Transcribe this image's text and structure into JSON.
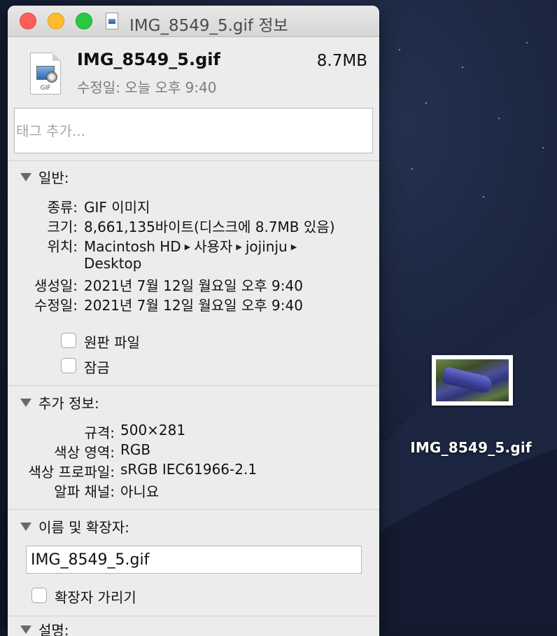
{
  "window": {
    "title": "IMG_8549_5.gif 정보"
  },
  "header": {
    "file_name": "IMG_8549_5.gif",
    "file_size": "8.7MB",
    "modified": "수정일: 오늘 오후 9:40",
    "icon_ext": "GIF"
  },
  "tags": {
    "placeholder": "태그 추가..."
  },
  "general": {
    "heading": "일반:",
    "kind_label": "종류:",
    "kind_value": "GIF 이미지",
    "size_label": "크기:",
    "size_value": "8,661,135바이트(디스크에 8.7MB 있음)",
    "where_label": "위치:",
    "where_path": [
      "Macintosh HD",
      "사용자",
      "jojinju",
      "Desktop"
    ],
    "created_label": "생성일:",
    "created_value": "2021년 7월 12일 월요일 오후 9:40",
    "modified_label": "수정일:",
    "modified_value": "2021년 7월 12일 월요일 오후 9:40",
    "stationery_label": "원판 파일",
    "locked_label": "잠금"
  },
  "more_info": {
    "heading": "추가 정보:",
    "dimensions_label": "규격:",
    "dimensions_value": "500×281",
    "color_space_label": "색상 영역:",
    "color_space_value": "RGB",
    "color_profile_label": "색상 프로파일:",
    "color_profile_value": "sRGB IEC61966-2.1",
    "alpha_label": "알파 채널:",
    "alpha_value": "아니요"
  },
  "name_ext": {
    "heading": "이름 및 확장자:",
    "name_value": "IMG_8549_5.gif",
    "hide_ext_label": "확장자 가리기"
  },
  "next_section": {
    "heading": "설명:"
  },
  "desktop": {
    "icon_label": "IMG_8549_5.gif"
  }
}
